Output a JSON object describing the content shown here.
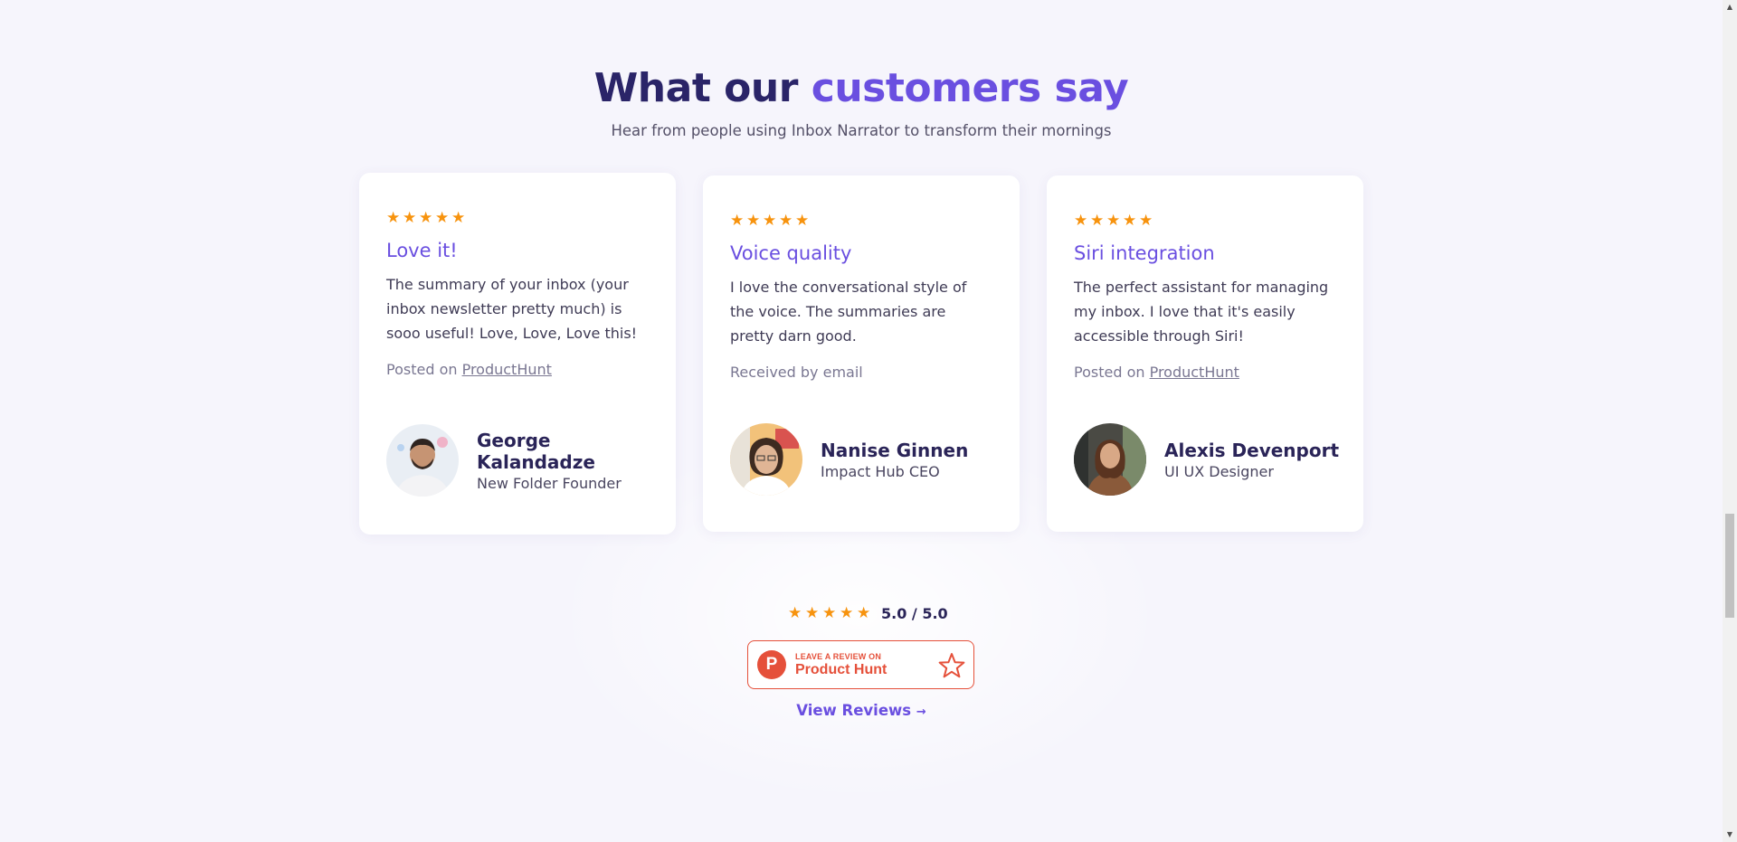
{
  "section": {
    "title_prefix": "What our ",
    "title_accent": "customers say",
    "subtitle": "Hear from people using Inbox Narrator to transform their mornings"
  },
  "colors": {
    "accent": "#6a4fe0",
    "heading": "#2a2468",
    "star": "#f7930e",
    "producthunt": "#e5503a"
  },
  "testimonials": [
    {
      "rating": 5,
      "title": "Love it!",
      "text": "The summary of your inbox (your inbox newsletter pretty much) is sooo useful! Love, Love, Love this!",
      "source_prefix": "Posted on ",
      "source_link": "ProductHunt",
      "name": "George Kalandadze",
      "role": "New Folder Founder",
      "avatar_icon": "avatar-photo"
    },
    {
      "rating": 5,
      "title": "Voice quality",
      "text": "I love the conversational style of the voice. The summaries are pretty darn good.",
      "source_prefix": "Received by email",
      "source_link": "",
      "name": "Nanise Ginnen",
      "role": "Impact Hub CEO",
      "avatar_icon": "avatar-photo"
    },
    {
      "rating": 5,
      "title": "Siri integration",
      "text": "The perfect assistant for managing my inbox. I love that it's easily accessible through Siri!",
      "source_prefix": "Posted on ",
      "source_link": "ProductHunt",
      "name": "Alexis Devenport",
      "role": "UI UX Designer",
      "avatar_icon": "avatar-photo"
    }
  ],
  "overall": {
    "rating": 5,
    "score_text": "5.0 / 5.0"
  },
  "product_hunt_badge": {
    "logo_letter": "P",
    "small_text": "LEAVE A REVIEW ON",
    "big_text": "Product Hunt",
    "icon": "star-outline-icon"
  },
  "view_reviews": {
    "label": "View Reviews",
    "arrow": "→"
  }
}
